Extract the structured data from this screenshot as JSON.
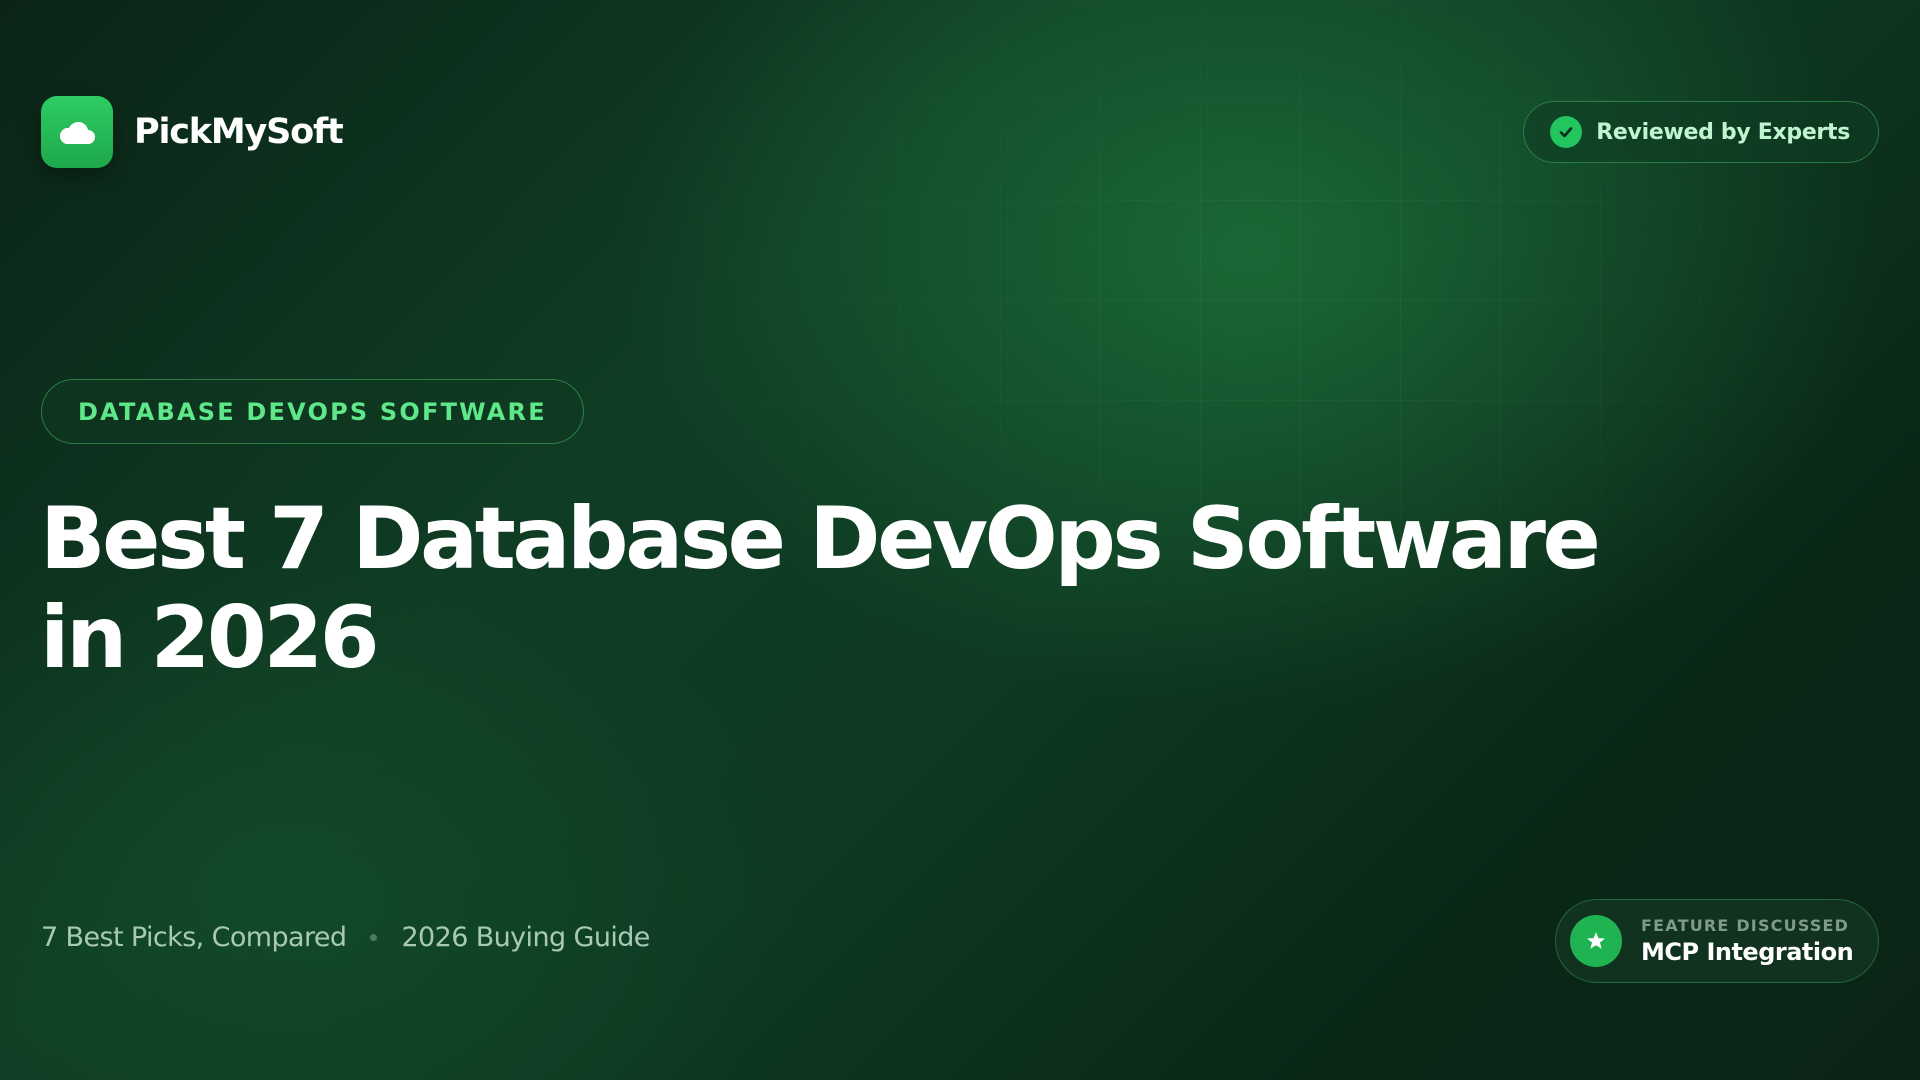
{
  "brand": {
    "name": "PickMySoft",
    "icon": "cloud-icon",
    "accent_color": "#22c55e"
  },
  "badge": {
    "label": "Reviewed by Experts",
    "icon": "check-icon"
  },
  "category": {
    "label": "DATABASE DEVOPS SOFTWARE"
  },
  "title": {
    "line1": "Best 7 Database DevOps Software",
    "line2": "in 2026"
  },
  "meta": {
    "picks": "7 Best Picks, Compared",
    "guide": "2026 Buying Guide"
  },
  "feature": {
    "label": "FEATURE DISCUSSED",
    "value": "MCP Integration",
    "icon": "star-icon"
  }
}
